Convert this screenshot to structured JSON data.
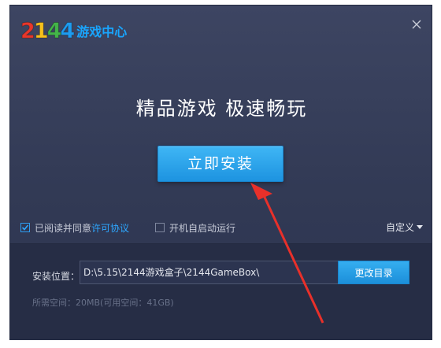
{
  "app": {
    "logo_digits": [
      "2",
      "1",
      "4",
      "4"
    ],
    "logo_digit_colors": [
      "#e8372b",
      "#f7c11c",
      "#44b549",
      "#1e9cf0"
    ],
    "logo_text": "游戏中心"
  },
  "header": {
    "close_icon": "close-icon"
  },
  "main": {
    "slogan": "精品游戏  极速畅玩",
    "install_label": "立即安装"
  },
  "options": {
    "agree_prefix": "已阅读并同意",
    "agree_link": "许可协议",
    "agree_checked": true,
    "autostart_label": "开机自启动运行",
    "autostart_checked": false,
    "custom_label": "自定义"
  },
  "install": {
    "path_label": "安装位置：",
    "path_value": "D:\\5.15\\2144游戏盒子\\2144GameBox\\",
    "change_dir_label": "更改目录",
    "space_info": "所需空间：20MB(可用空间：41GB)"
  },
  "colors": {
    "accent": "#1e9cf0",
    "link": "#2da7ff",
    "annotation_arrow": "#e8302a"
  }
}
